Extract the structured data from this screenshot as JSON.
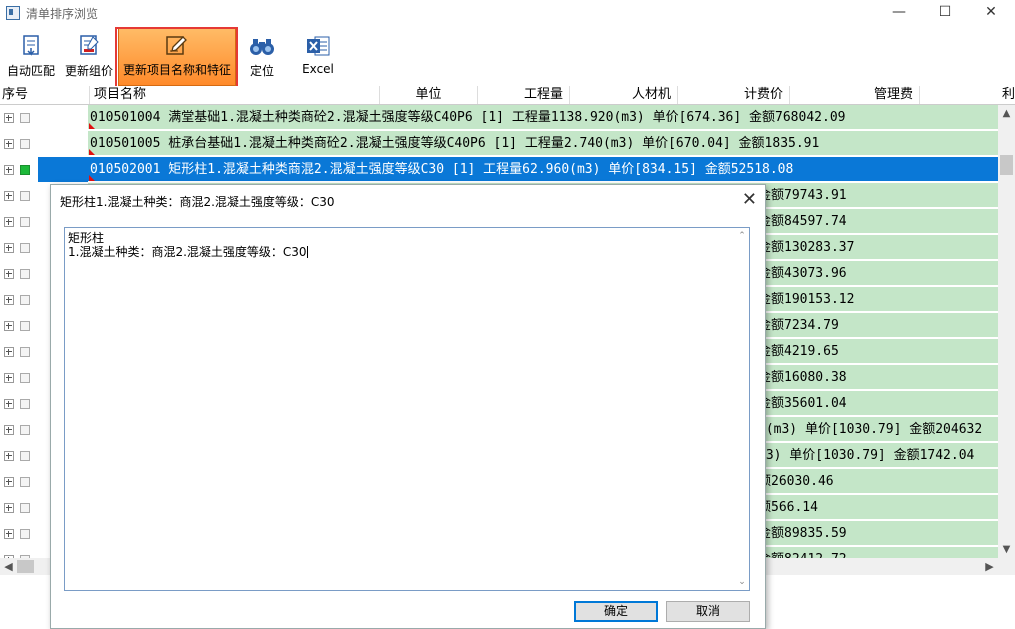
{
  "window": {
    "title": "清单排序浏览",
    "minimize": "—",
    "maximize": "☐",
    "close": "✕"
  },
  "toolbar": {
    "buttons": [
      {
        "label": "自动匹配",
        "icon": "auto-match-icon"
      },
      {
        "label": "更新组价",
        "icon": "update-price-icon"
      },
      {
        "label": "更新项目名称和特征",
        "icon": "edit-icon",
        "active": true
      },
      {
        "label": "定位",
        "icon": "binoculars-icon"
      },
      {
        "label": "Excel",
        "icon": "excel-icon"
      }
    ]
  },
  "columns": [
    "序号",
    "项目名称",
    "单位",
    "工程量",
    "人材机",
    "计费价",
    "管理费",
    "利"
  ],
  "rows": [
    {
      "text": "010501004 满堂基础1.混凝土种类商砼2.混凝土强度等级C40P6 [1] 工程量1138.920(m3) 单价[674.36] 金额768042.09"
    },
    {
      "text": "010501005 桩承台基础1.混凝土种类商砼2.混凝土强度等级C40P6 [1] 工程量2.740(m3) 单价[670.04] 金额1835.91"
    },
    {
      "text": "010502001 矩形柱1.混凝土种类商混2.混凝土强度等级C30 [1] 工程量62.960(m3) 单价[834.15] 金额52518.08",
      "selected": true
    },
    {
      "text": "金额79743.91"
    },
    {
      "text": "金额84597.74"
    },
    {
      "text": " 金额130283.37"
    },
    {
      "text": "金额43073.96"
    },
    {
      "text": "  金额190153.12"
    },
    {
      "text": "金额7234.79"
    },
    {
      "text": " 金额4219.65"
    },
    {
      "text": "金额16080.38"
    },
    {
      "text": "金额35601.04"
    },
    {
      "text": "0(m3) 单价[1030.79] 金额204632"
    },
    {
      "text": "m3) 单价[1030.79] 金额1742.04"
    },
    {
      "text": "额26030.46"
    },
    {
      "text": "额566.14"
    },
    {
      "text": " 金额89835.59"
    },
    {
      "text": " 金额82412.72"
    }
  ],
  "dialog": {
    "title": "矩形柱1.混凝土种类：商混2.混凝土强度等级：C30",
    "close": "✕",
    "line1": "矩形柱",
    "line2": "1.混凝土种类：商混2.混凝土强度等级：C30",
    "ok": "确定",
    "cancel": "取消"
  },
  "colors": {
    "row_bg": "#c4e6c8",
    "selected_bg": "#0a78d7",
    "active_btn": "#ff8a2a"
  }
}
